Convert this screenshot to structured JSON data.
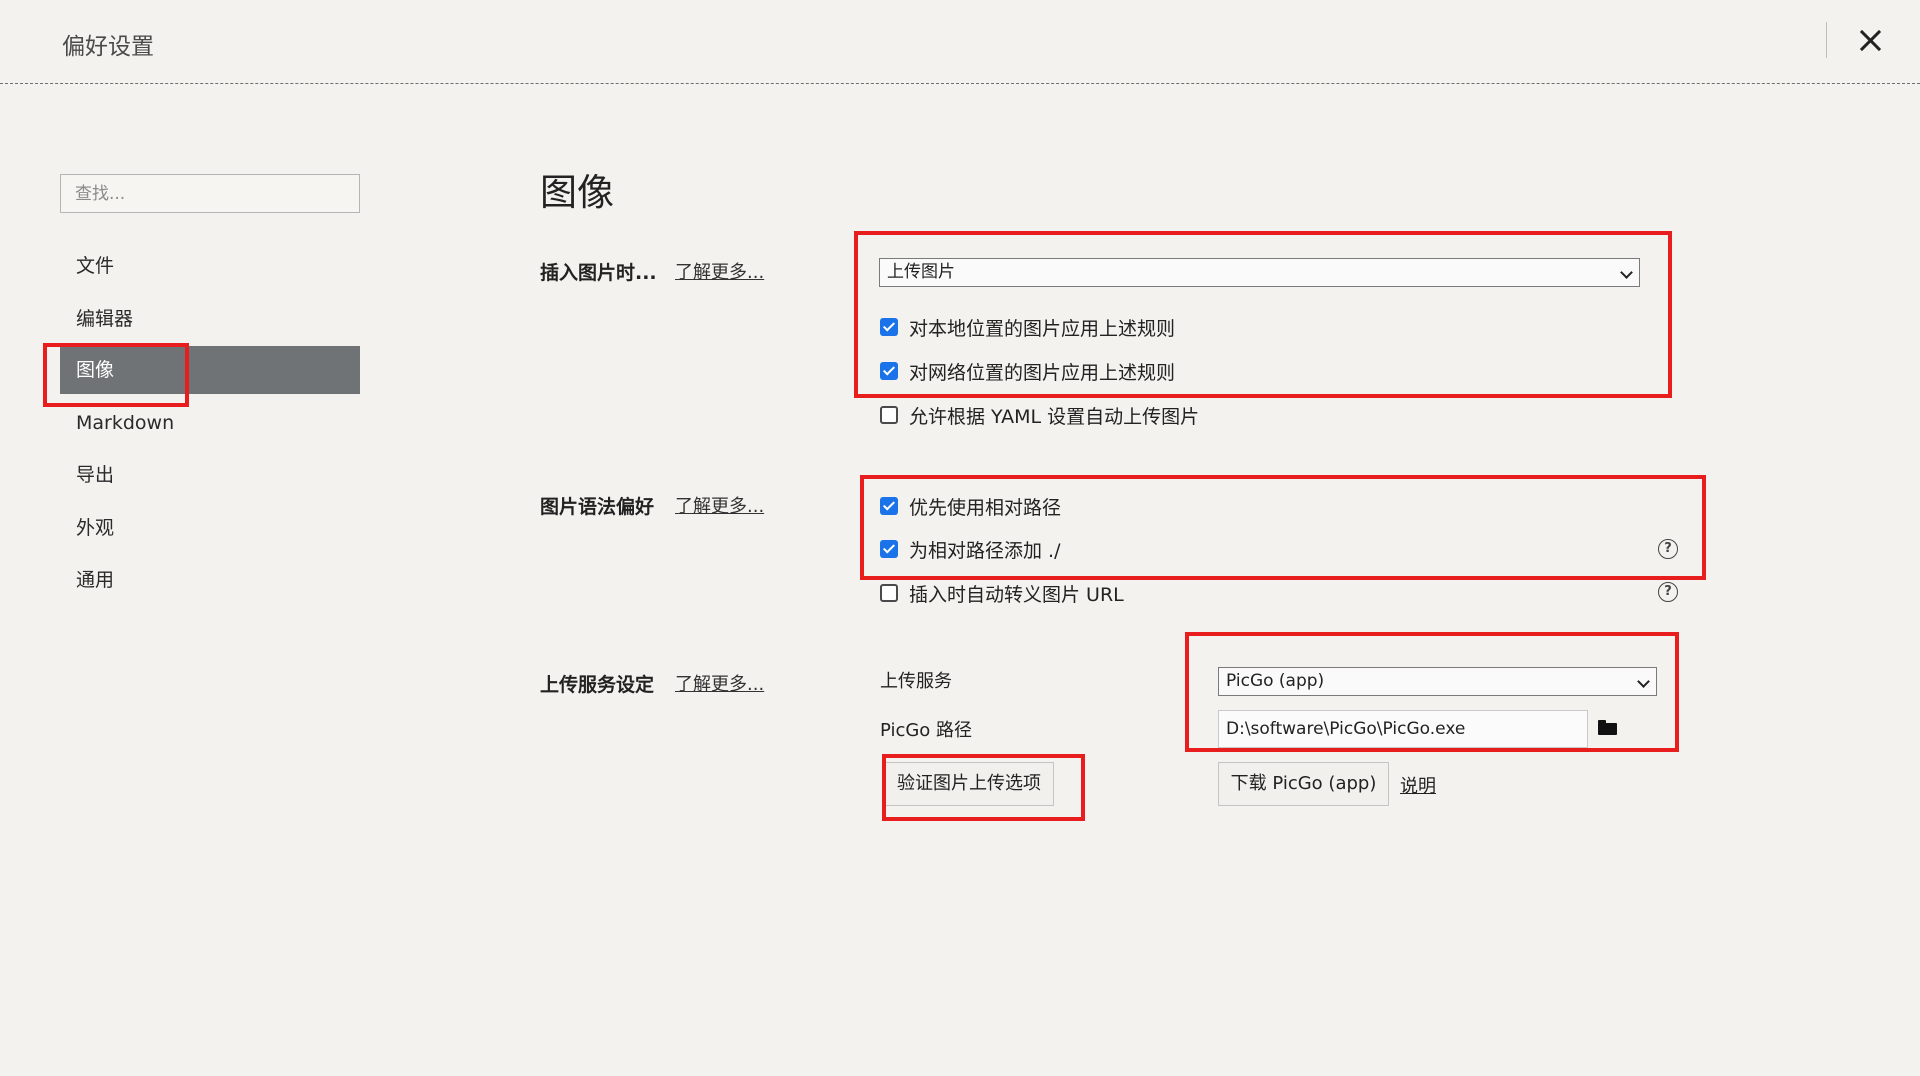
{
  "header": {
    "title": "偏好设置"
  },
  "sidebar": {
    "search_placeholder": "查找...",
    "items": [
      {
        "label": "文件"
      },
      {
        "label": "编辑器"
      },
      {
        "label": "图像",
        "active": true
      },
      {
        "label": "Markdown"
      },
      {
        "label": "导出"
      },
      {
        "label": "外观"
      },
      {
        "label": "通用"
      }
    ]
  },
  "main": {
    "title": "图像",
    "insert_section": {
      "label": "插入图片时...",
      "learn_more": "了解更多...",
      "action_select": "上传图片",
      "options": [
        {
          "label": "对本地位置的图片应用上述规则",
          "checked": true
        },
        {
          "label": "对网络位置的图片应用上述规则",
          "checked": true
        },
        {
          "label": "允许根据 YAML 设置自动上传图片",
          "checked": false
        }
      ]
    },
    "syntax_section": {
      "label": "图片语法偏好",
      "learn_more": "了解更多...",
      "options": [
        {
          "label": "优先使用相对路径",
          "checked": true
        },
        {
          "label": "为相对路径添加 ./",
          "checked": true,
          "help": true
        },
        {
          "label": "插入时自动转义图片 URL",
          "checked": false,
          "help": true
        }
      ],
      "help_glyph": "?"
    },
    "upload_section": {
      "label": "上传服务设定",
      "learn_more": "了解更多...",
      "service_label": "上传服务",
      "service_value": "PicGo (app)",
      "path_label": "PicGo 路径",
      "path_value": "D:\\software\\PicGo\\PicGo.exe",
      "verify_button": "验证图片上传选项",
      "download_button": "下载 PicGo (app)",
      "help_link": "说明"
    }
  },
  "annotation_color": "#e81e1e",
  "accent_color": "#1a73e8"
}
